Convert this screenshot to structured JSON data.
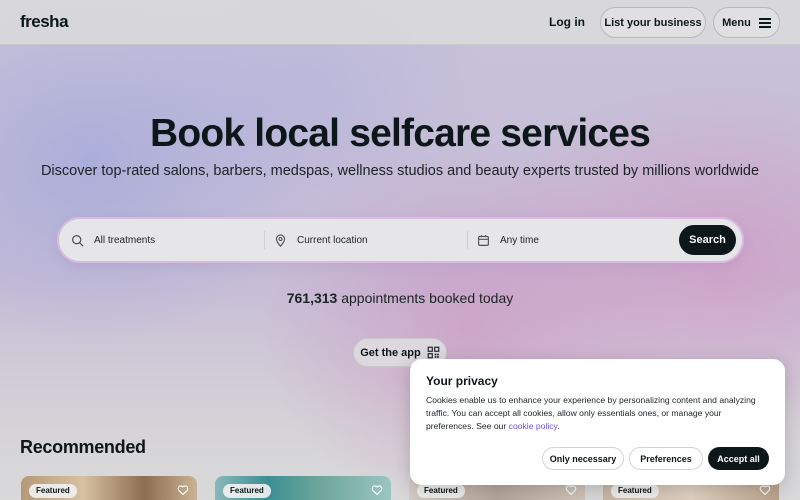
{
  "header": {
    "logo": "fresha",
    "login_label": "Log in",
    "list_business_label": "List your business",
    "menu_label": "Menu"
  },
  "hero": {
    "title": "Book local selfcare services",
    "subtitle": "Discover top-rated salons, barbers, medspas, wellness studios and beauty experts trusted by millions worldwide"
  },
  "search": {
    "treatments_placeholder": "All treatments",
    "location_placeholder": "Current location",
    "time_placeholder": "Any time",
    "button_label": "Search"
  },
  "stats": {
    "count": "761,313",
    "suffix": "appointments booked today"
  },
  "app": {
    "label": "Get the app"
  },
  "recommended": {
    "title": "Recommended",
    "cards": [
      {
        "badge": "Featured"
      },
      {
        "badge": "Featured"
      },
      {
        "badge": "Featured"
      },
      {
        "badge": "Featured"
      }
    ]
  },
  "privacy": {
    "title": "Your privacy",
    "text": "Cookies enable us to enhance your experience by personalizing content and analyzing traffic. You can accept all cookies, allow only essentials ones, or manage your preferences. See our",
    "link_text": "cookie policy",
    "text_end": ".",
    "only_necessary_label": "Only necessary",
    "preferences_label": "Preferences",
    "accept_all_label": "Accept all"
  },
  "icons": {
    "search": "search-icon",
    "location": "location-pin-icon",
    "calendar": "calendar-icon",
    "qr": "qr-code-icon",
    "heart": "heart-icon",
    "menu": "hamburger-menu-icon"
  },
  "colors": {
    "primary_dark": "#0d1619",
    "link": "#6950f3"
  }
}
